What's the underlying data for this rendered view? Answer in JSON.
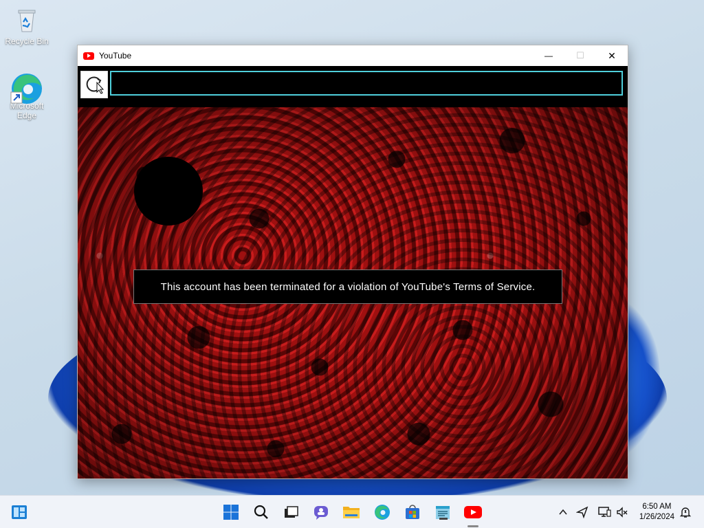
{
  "desktop": {
    "icons": [
      {
        "label": "Recycle Bin",
        "icon": "recycle-bin-icon"
      },
      {
        "label": "Microsoft Edge",
        "icon": "edge-icon"
      }
    ]
  },
  "window": {
    "title": "YouTube",
    "icon": "youtube-icon",
    "controls": {
      "minimize": "—",
      "maximize": "☐",
      "close": "✕"
    }
  },
  "page": {
    "notice_text": "This account has been terminated for a violation of YouTube's Terms of Service.",
    "reload_icon": "refresh-icon",
    "address_value": ""
  },
  "taskbar": {
    "apps": [
      "widgets-icon",
      "start-icon",
      "search-icon",
      "task-view-icon",
      "chat-icon",
      "file-explorer-icon",
      "edge-icon",
      "store-icon",
      "notepad-icon",
      "youtube-icon"
    ],
    "time": "6:50 AM",
    "date": "1/26/2024"
  },
  "colors": {
    "accent_border": "#4fd0dc",
    "youtube_red": "#ff0000"
  }
}
